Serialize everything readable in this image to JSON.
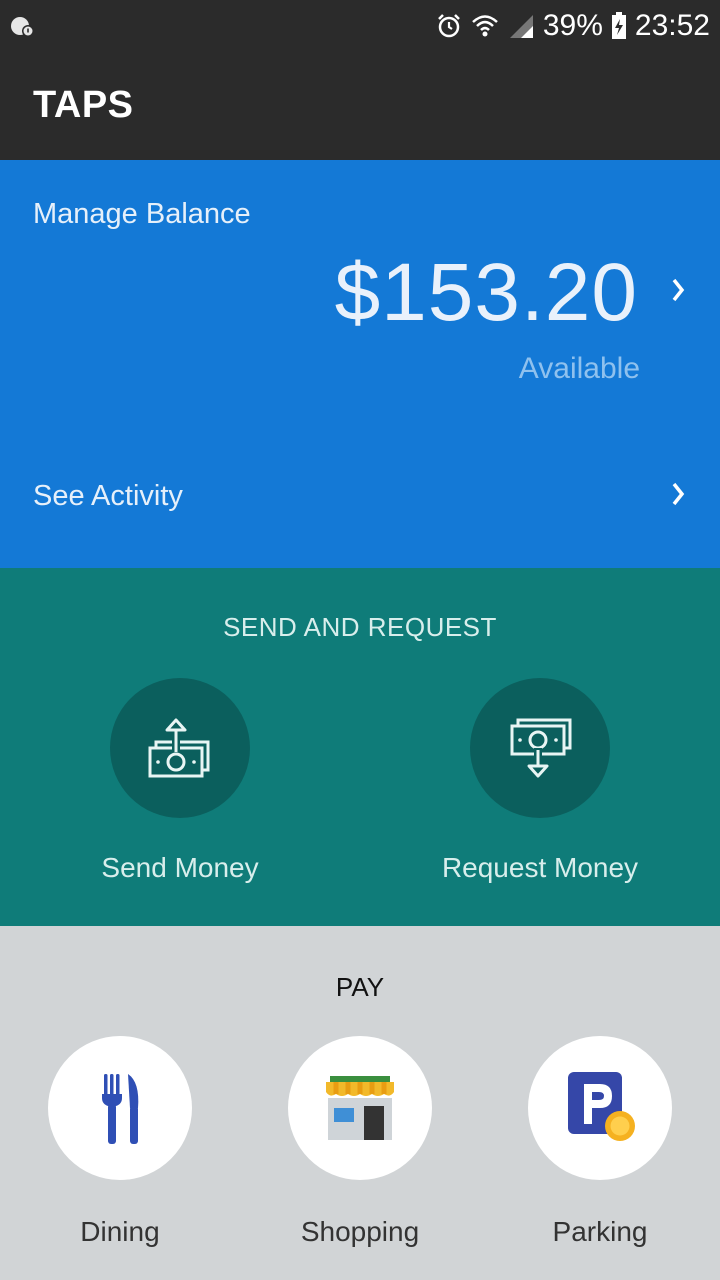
{
  "status_bar": {
    "battery_percent": "39%",
    "time": "23:52",
    "icons": [
      "notification-icon",
      "alarm-icon",
      "wifi-icon",
      "signal-icon",
      "battery-icon"
    ]
  },
  "app_bar": {
    "title": "TAPS"
  },
  "balance": {
    "manage_label": "Manage Balance",
    "amount": "$153.20",
    "available_label": "Available",
    "see_activity_label": "See Activity"
  },
  "send_request": {
    "header": "SEND AND REQUEST",
    "send_label": "Send Money",
    "request_label": "Request Money"
  },
  "pay": {
    "header": "PAY",
    "items": [
      {
        "label": "Dining",
        "icon": "dining-icon"
      },
      {
        "label": "Shopping",
        "icon": "shopping-icon"
      },
      {
        "label": "Parking",
        "icon": "parking-icon"
      }
    ]
  },
  "colors": {
    "app_bar": "#2b2b2b",
    "balance_bg": "#1479d6",
    "send_bg": "#0f7c79",
    "send_circle": "#0b5f5d",
    "pay_bg": "#d1d4d6"
  }
}
